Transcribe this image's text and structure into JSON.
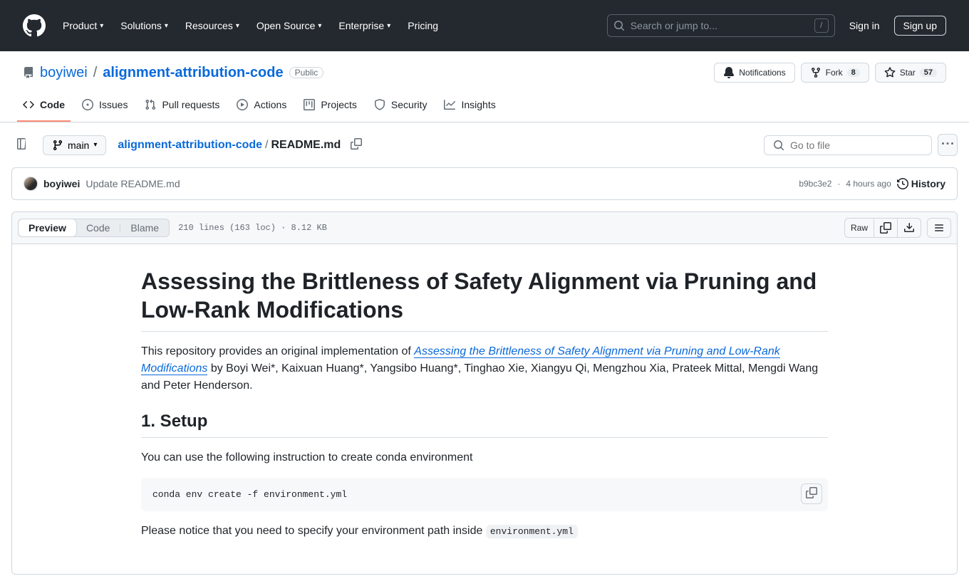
{
  "header": {
    "nav": [
      "Product",
      "Solutions",
      "Resources",
      "Open Source",
      "Enterprise",
      "Pricing"
    ],
    "search_placeholder": "Search or jump to...",
    "slash": "/",
    "sign_in": "Sign in",
    "sign_up": "Sign up"
  },
  "repo": {
    "owner": "boyiwei",
    "name": "alignment-attribution-code",
    "visibility": "Public",
    "notifications": "Notifications",
    "fork": "Fork",
    "fork_count": "8",
    "star": "Star",
    "star_count": "57"
  },
  "tabs": [
    "Code",
    "Issues",
    "Pull requests",
    "Actions",
    "Projects",
    "Security",
    "Insights"
  ],
  "filebar": {
    "branch": "main",
    "crumb_root": "alignment-attribution-code",
    "crumb_sep": "/",
    "crumb_file": "README.md",
    "goto_placeholder": "Go to file"
  },
  "commit": {
    "author": "boyiwei",
    "message": "Update README.md",
    "sha": "b9bc3e2",
    "sep": "·",
    "time": "4 hours ago",
    "history": "History"
  },
  "filetoolbar": {
    "preview": "Preview",
    "code": "Code",
    "blame": "Blame",
    "info": "210 lines (163 loc) · 8.12 KB",
    "raw": "Raw"
  },
  "readme": {
    "h1": "Assessing the Brittleness of Safety Alignment via Pruning and Low-Rank Modifications",
    "p1_pre": "This repository provides an original implementation of ",
    "p1_link": "Assessing the Brittleness of Safety Alignment via Pruning and Low-Rank Modifications",
    "p1_post": " by Boyi Wei*, Kaixuan Huang*, Yangsibo Huang*, Tinghao Xie, Xiangyu Qi, Mengzhou Xia, Prateek Mittal, Mengdi Wang and Peter Henderson.",
    "h2": "1. Setup",
    "p2": "You can use the following instruction to create conda environment",
    "code": "conda env create -f environment.yml",
    "p3_pre": "Please notice that you need to specify your environment path inside ",
    "p3_code": "environment.yml"
  }
}
